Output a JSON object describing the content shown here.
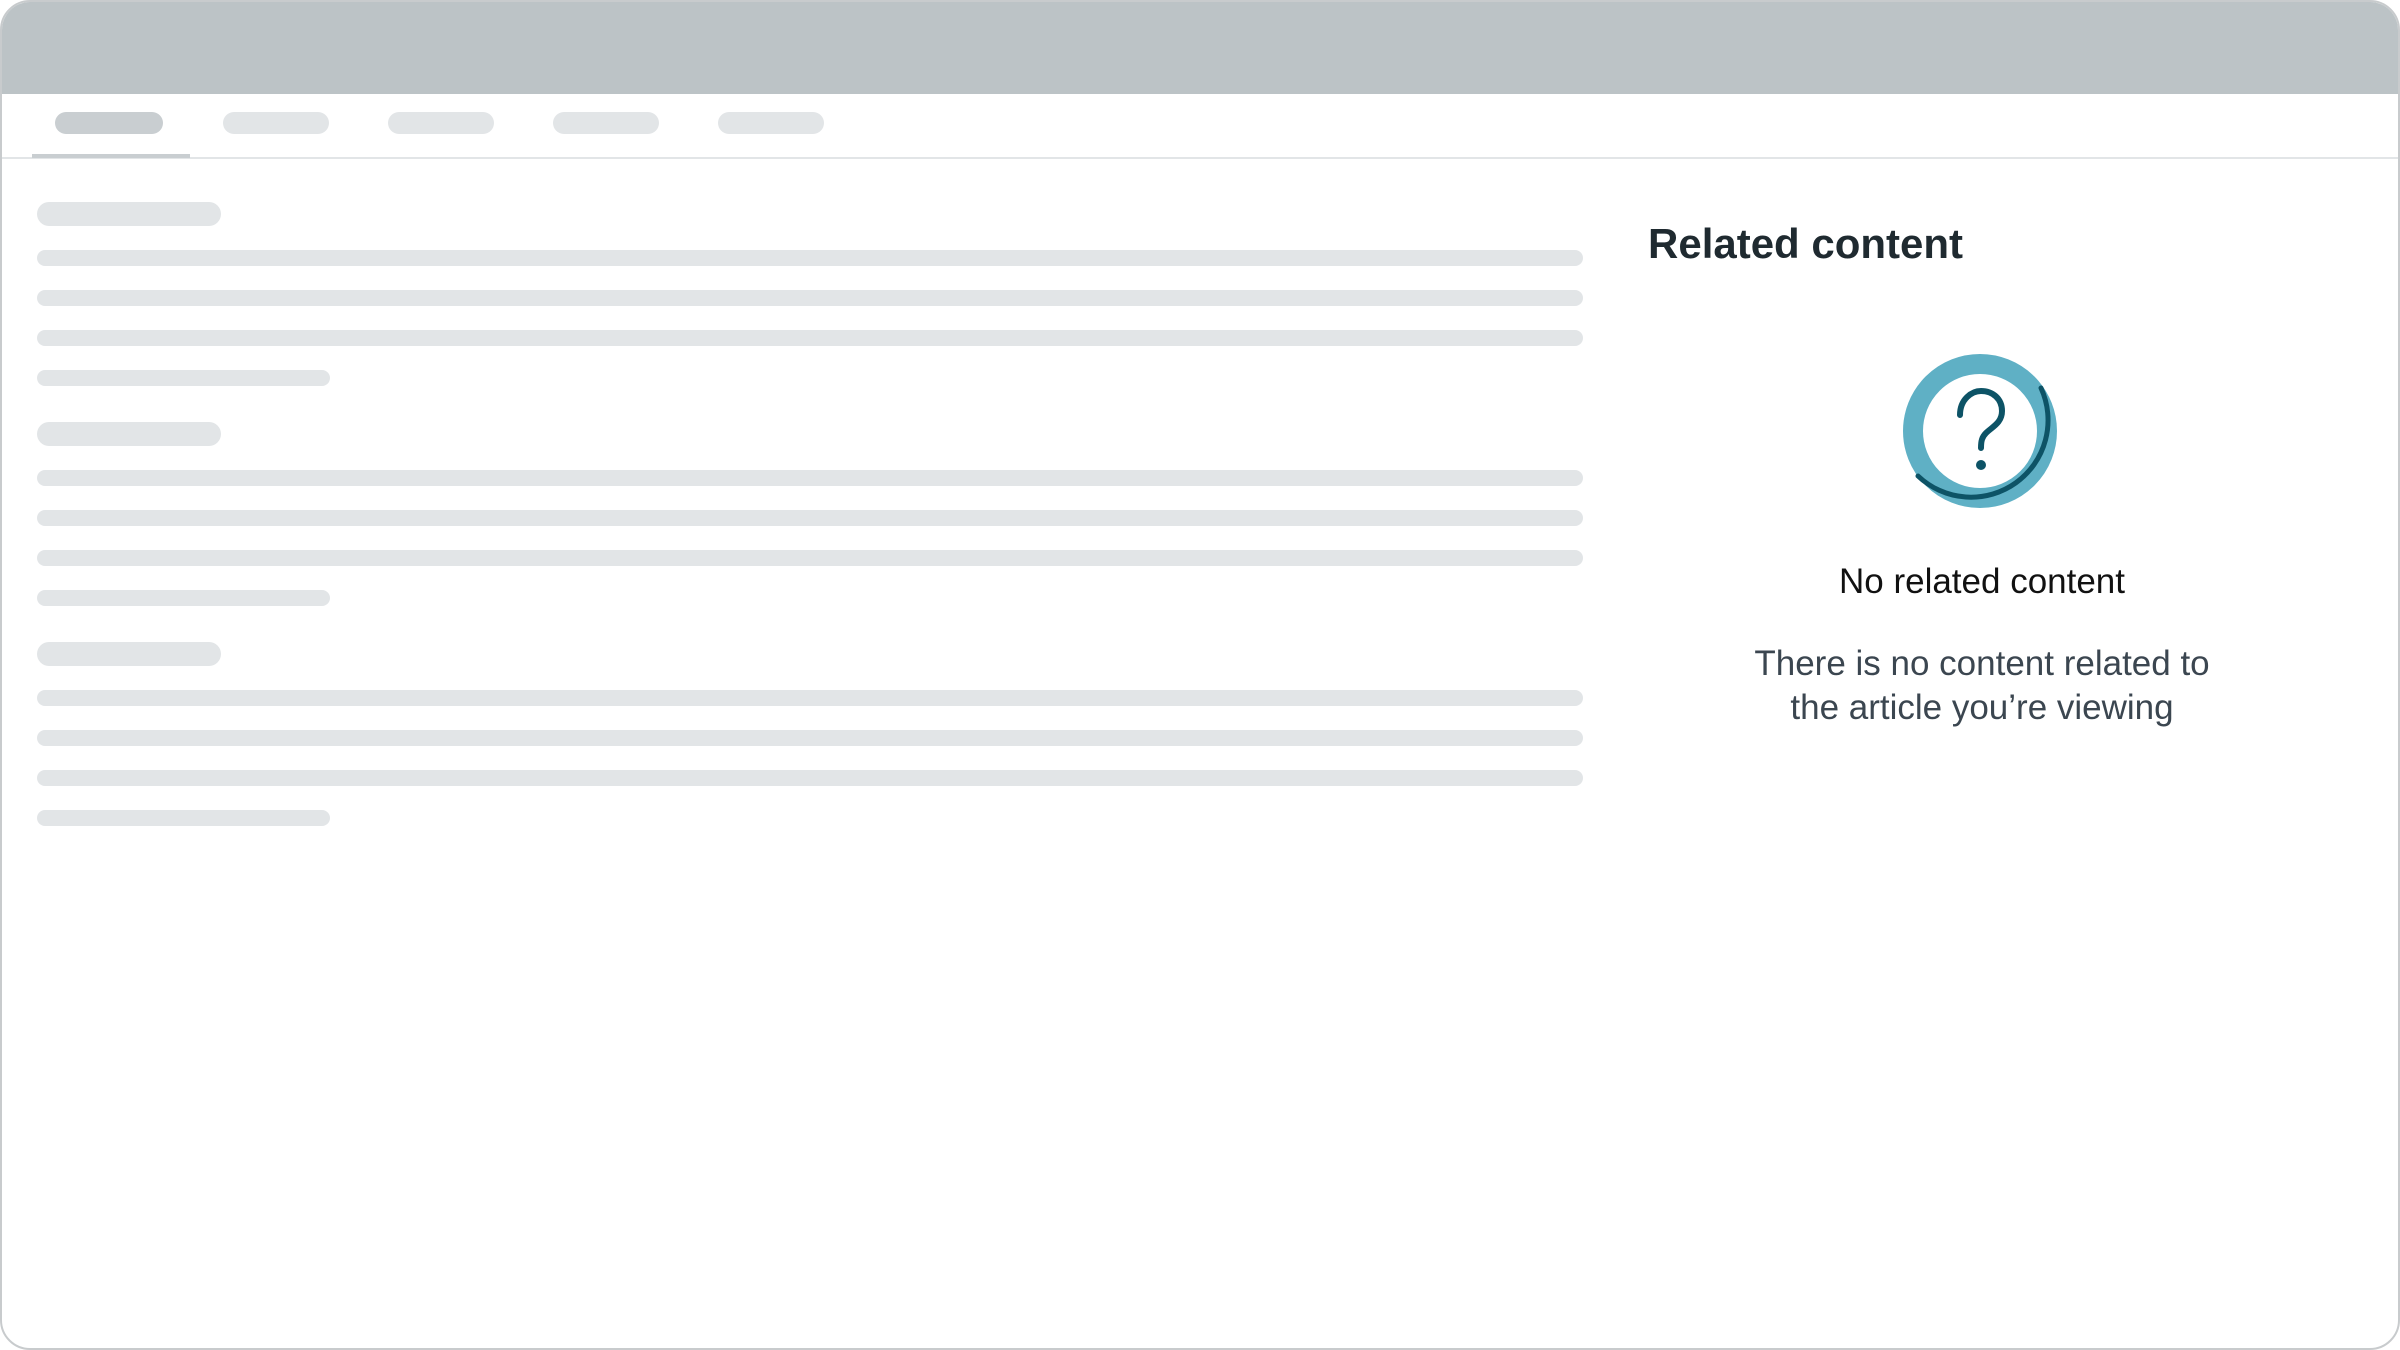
{
  "sidebar": {
    "title": "Related content",
    "empty_state": {
      "icon": "question-circle-icon",
      "heading": "No related content",
      "body_line1": "There is no content related to",
      "body_line2": "the article you’re viewing"
    }
  },
  "colors": {
    "titlebar": "#bcc3c6",
    "skeleton": "#e2e5e7",
    "icon_ring_light": "#5fb0c5",
    "icon_ring_dark": "#0d5366",
    "icon_glyph": "#0d5366"
  }
}
